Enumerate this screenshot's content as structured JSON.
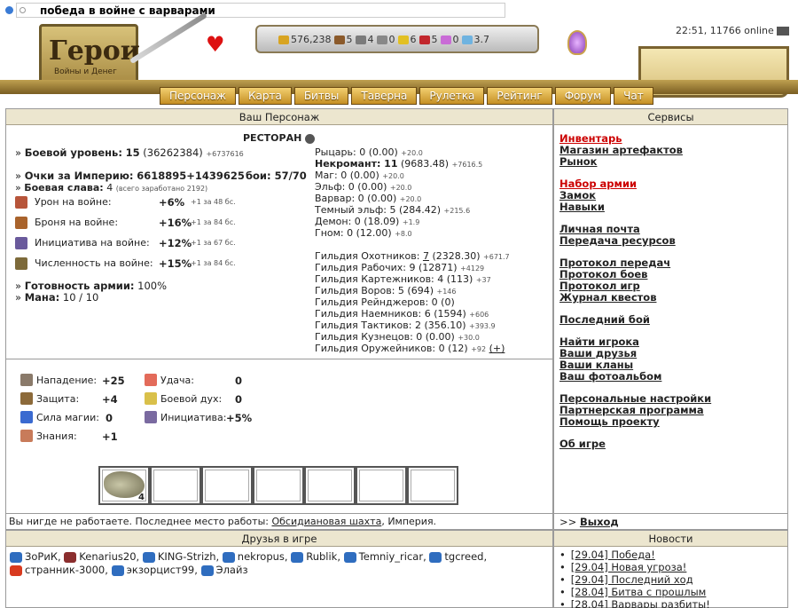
{
  "browser": {
    "search_text": "победа в войне с варварами"
  },
  "logo": {
    "title": "Герои",
    "subtitle": "Войны и Денег"
  },
  "resources": [
    {
      "icon": "gold-icon",
      "value": "576,238",
      "color": "#d8a421"
    },
    {
      "icon": "wood-icon",
      "value": "5",
      "color": "#8b5a2b"
    },
    {
      "icon": "ore-icon",
      "value": "4",
      "color": "#7b7b7b"
    },
    {
      "icon": "mercury-icon",
      "value": "0",
      "color": "#888888"
    },
    {
      "icon": "sulfur-icon",
      "value": "6",
      "color": "#e2c023"
    },
    {
      "icon": "crystal-icon",
      "value": "5",
      "color": "#c2272d"
    },
    {
      "icon": "gems-icon",
      "value": "0",
      "color": "#c96bd6"
    },
    {
      "icon": "diamond-icon",
      "value": "3.7",
      "color": "#6fb3e0"
    }
  ],
  "status": {
    "time_online": "22:51, 11766 online"
  },
  "nav": [
    "Персонаж",
    "Карта",
    "Битвы",
    "Таверна",
    "Рулетка",
    "Рейтинг",
    "Форум",
    "Чат"
  ],
  "character": {
    "title": "Ваш Персонаж",
    "location": "РЕСТОРАН",
    "combat_level_label": "Боевой уровень:",
    "combat_level": "15",
    "combat_level_exp": "(36262384)",
    "combat_level_gain": "+6737616",
    "empire_points_label": "Очки за Империю:",
    "empire_points": "6618895+1439625",
    "battles": "бои: 57/70",
    "glory_label": "Боевая слава:",
    "glory": "4",
    "glory_total": "(всего заработано 2192)",
    "war_bonuses": [
      {
        "icon": "damage-icon",
        "label": "Урон на войне:",
        "value": "+6%",
        "note": "+1 за 48 бс."
      },
      {
        "icon": "armor-icon",
        "label": "Броня на войне:",
        "value": "+16%",
        "note": "+1 за 84 бс."
      },
      {
        "icon": "initiative-icon",
        "label": "Инициатива на войне:",
        "value": "+12%",
        "note": "+1 за 67 бс."
      },
      {
        "icon": "numbers-icon",
        "label": "Численность на войне:",
        "value": "+15%",
        "note": "+1 за 84 бс."
      }
    ],
    "army_ready_label": "Готовность армии:",
    "army_ready": "100%",
    "mana_label": "Мана:",
    "mana": "10 / 10",
    "factions": [
      {
        "label": "Рыцарь: 0 (0.00)",
        "gain": "+20.0"
      },
      {
        "label": "Некромант: 11",
        "detail": "(9683.48)",
        "gain": "+7616.5",
        "bold": true
      },
      {
        "label": "Маг: 0 (0.00)",
        "gain": "+20.0"
      },
      {
        "label": "Эльф: 0 (0.00)",
        "gain": "+20.0"
      },
      {
        "label": "Варвар: 0 (0.00)",
        "gain": "+20.0"
      },
      {
        "label": "Темный эльф: 5 (284.42)",
        "gain": "+215.6"
      },
      {
        "label": "Демон: 0 (18.09)",
        "gain": "+1.9"
      },
      {
        "label": "Гном: 0 (12.00)",
        "gain": "+8.0"
      }
    ],
    "guilds": [
      {
        "label": "Гильдия Охотников:",
        "level": "7",
        "detail": "(2328.30)",
        "gain": "+671.7"
      },
      {
        "label": "Гильдия Рабочих: 9 (12871)",
        "gain": "+4129"
      },
      {
        "label": "Гильдия Картежников: 4 (113)",
        "gain": "+37"
      },
      {
        "label": "Гильдия Воров: 5 (694)",
        "gain": "+146"
      },
      {
        "label": "Гильдия Рейнджеров: 0 (0)",
        "gain": ""
      },
      {
        "label": "Гильдия Наемников: 6 (1594)",
        "gain": "+606"
      },
      {
        "label": "Гильдия Тактиков: 2 (356.10)",
        "gain": "+393.9"
      },
      {
        "label": "Гильдия Кузнецов: 0 (0.00)",
        "gain": "+30.0"
      },
      {
        "label": "Гильдия Оружейников: 0 (12)",
        "gain": "+92",
        "extra": "(+)"
      }
    ],
    "stats_left": [
      {
        "icon": "attack-icon",
        "label": "Нападение:",
        "value": "+25"
      },
      {
        "icon": "defense-icon",
        "label": "Защита:",
        "value": "+4"
      },
      {
        "icon": "magic-power-icon",
        "label": "Сила магии:",
        "value": "0"
      },
      {
        "icon": "knowledge-icon",
        "label": "Знания:",
        "value": "+1"
      }
    ],
    "stats_right": [
      {
        "icon": "luck-icon",
        "label": "Удача:",
        "value": "0"
      },
      {
        "icon": "morale-icon",
        "label": "Боевой дух:",
        "value": "0"
      },
      {
        "icon": "initiative-stat-icon",
        "label": "Инициатива:",
        "value": "+5%"
      }
    ],
    "army_slot_count": "4",
    "work_text": "Вы нигде не работаете. Последнее место работы:",
    "work_place": "Обсидиановая шахта",
    "work_suffix": ", Империя."
  },
  "services": {
    "title": "Сервисы",
    "groups": [
      [
        {
          "label": "Инвентарь",
          "red": true
        },
        {
          "label": "Магазин артефактов"
        },
        {
          "label": "Рынок"
        }
      ],
      [
        {
          "label": "Набор армии",
          "red": true
        },
        {
          "label": "Замок"
        },
        {
          "label": "Навыки"
        }
      ],
      [
        {
          "label": "Личная почта"
        },
        {
          "label": "Передача ресурсов"
        }
      ],
      [
        {
          "label": "Протокол передач"
        },
        {
          "label": "Протокол боев"
        },
        {
          "label": "Протокол игр"
        },
        {
          "label": "Журнал квестов"
        }
      ],
      [
        {
          "label": "Последний бой"
        }
      ],
      [
        {
          "label": "Найти игрока"
        },
        {
          "label": "Ваши друзья"
        },
        {
          "label": "Ваши кланы"
        },
        {
          "label": "Ваш фотоальбом"
        }
      ],
      [
        {
          "label": "Персональные настройки"
        },
        {
          "label": "Партнерская программа"
        },
        {
          "label": "Помощь проекту"
        }
      ],
      [
        {
          "label": "Об игре"
        }
      ]
    ],
    "exit_prefix": ">>",
    "exit_label": "Выход"
  },
  "friends": {
    "title": "Друзья в игре",
    "list": [
      {
        "name": "ЗоРиК",
        "flag": "#2f6dbf"
      },
      {
        "name": "Kenarius20",
        "flag": "#8b2e2e"
      },
      {
        "name": "KING-Strizh",
        "flag": "#2f6dbf"
      },
      {
        "name": "nekropus",
        "flag": "#2f6dbf"
      },
      {
        "name": "Rublik",
        "flag": "#2f6dbf"
      },
      {
        "name": "Temniy_ricar",
        "flag": "#2f6dbf"
      },
      {
        "name": "tgcreed",
        "flag": "#2f6dbf"
      },
      {
        "name": "странник-3000",
        "flag": "#d83a1f"
      },
      {
        "name": "экзорцист99",
        "flag": "#2f6dbf"
      },
      {
        "name": "Элайз",
        "flag": "#2f6dbf"
      }
    ]
  },
  "news": {
    "title": "Новости",
    "items": [
      "[29.04] Победа!",
      "[29.04] Новая угроза!",
      "[29.04] Последний ход",
      "[28.04] Битва с прошлым",
      "[28.04] Варвары разбиты!"
    ]
  }
}
